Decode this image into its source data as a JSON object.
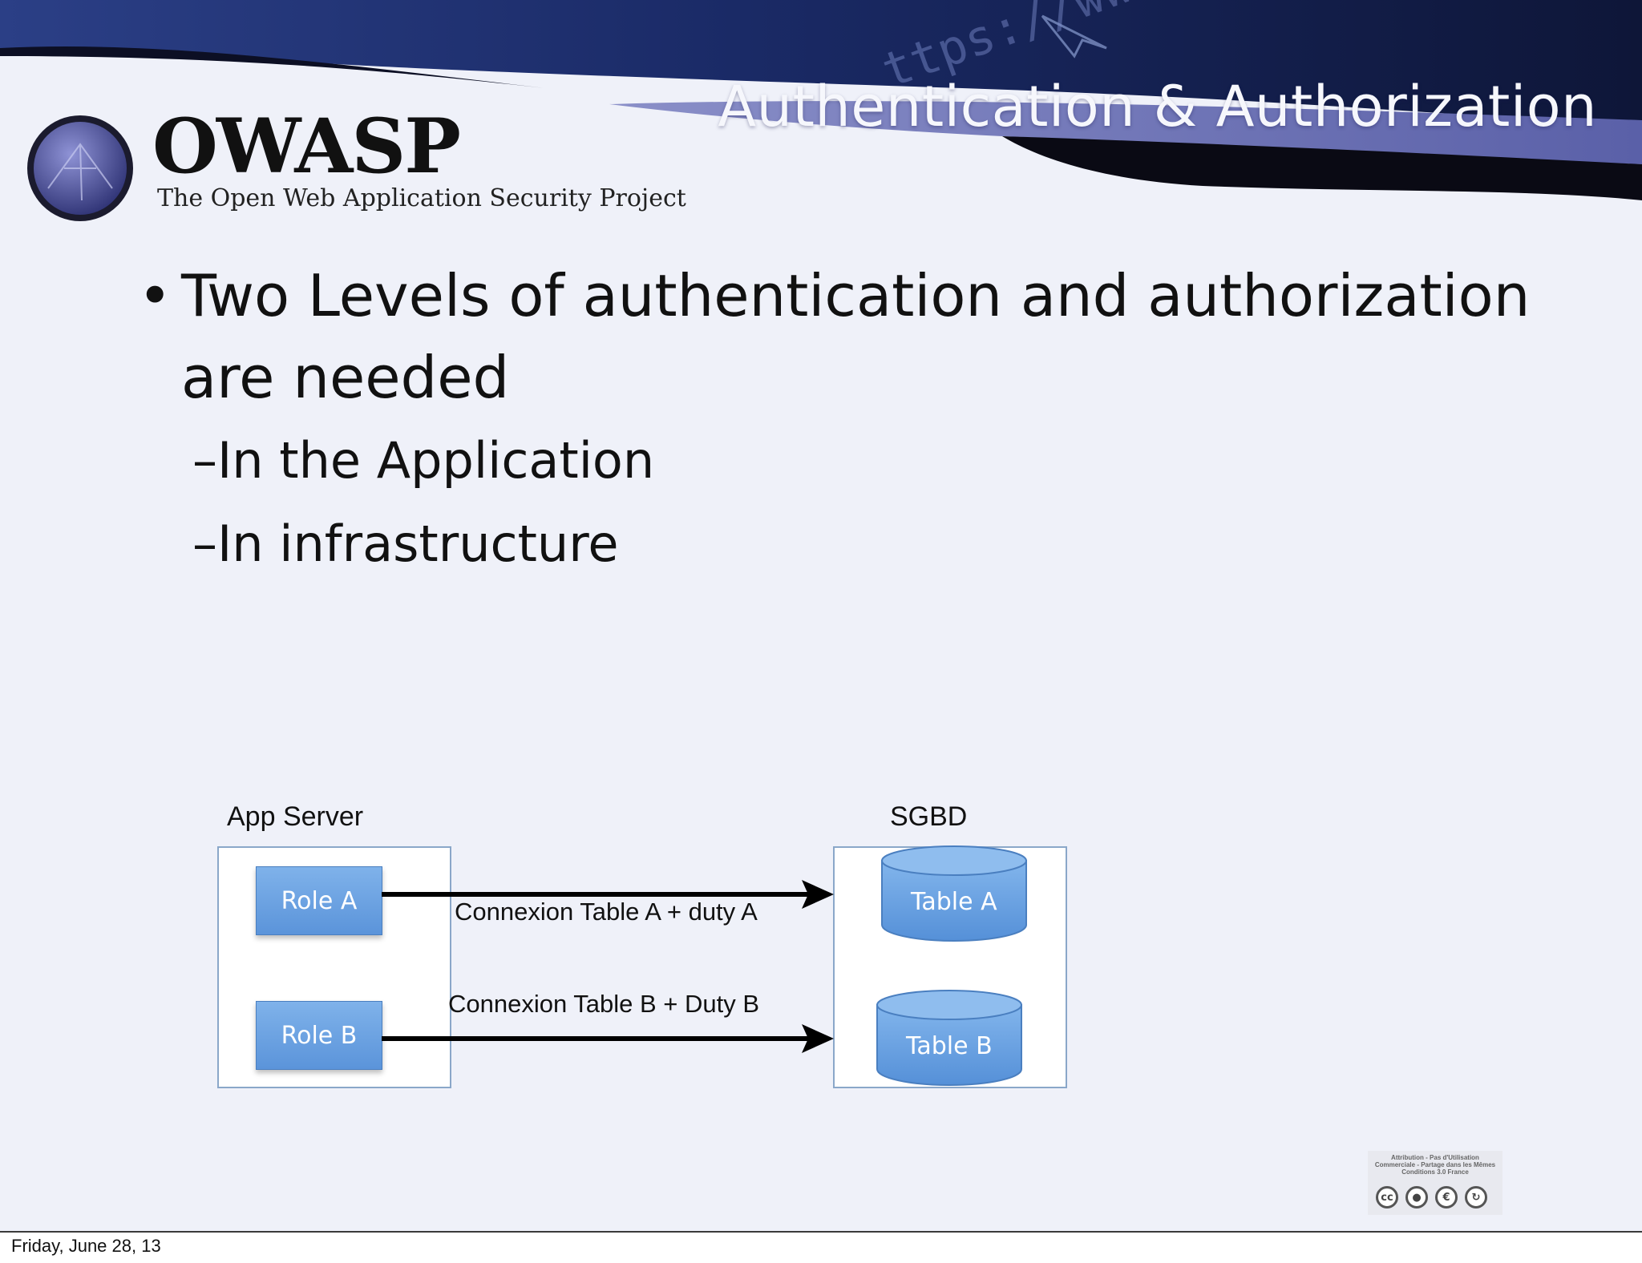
{
  "slide": {
    "title": "Authentication & Authorization",
    "logo": {
      "name": "OWASP",
      "tagline": "The Open Web Application Security Project"
    },
    "bullets": [
      {
        "text": "Two Levels of authentication and authorization are needed",
        "line1": "Two Levels of authentication and authorization",
        "line2": "are needed"
      }
    ],
    "sub_bullets": [
      {
        "dash": "–",
        "text": "In the Application"
      },
      {
        "dash": "–",
        "text": "In infrastructure"
      }
    ],
    "bullet_glyph": "•",
    "diagram": {
      "app_server_label": "App Server",
      "sgbd_label": "SGBD",
      "roles": [
        "Role A",
        "Role B"
      ],
      "tables": [
        "Table A",
        "Table B"
      ],
      "connections": [
        "Connexion Table A + duty  A",
        "Connexion Table B + Duty B"
      ]
    },
    "license": {
      "text": "Attribution - Pas d'Utilisation Commerciale - Partage dans les Mêmes Conditions 3.0 France",
      "icons": [
        "cc-icon",
        "attribution-icon",
        "noncommercial-icon",
        "share-alike-icon"
      ]
    },
    "colors": {
      "accent": "#6a6fb0",
      "background": "#eff1f9",
      "box_blue": "#5b94da"
    }
  },
  "footer": {
    "date": "Friday, June 28, 13"
  }
}
